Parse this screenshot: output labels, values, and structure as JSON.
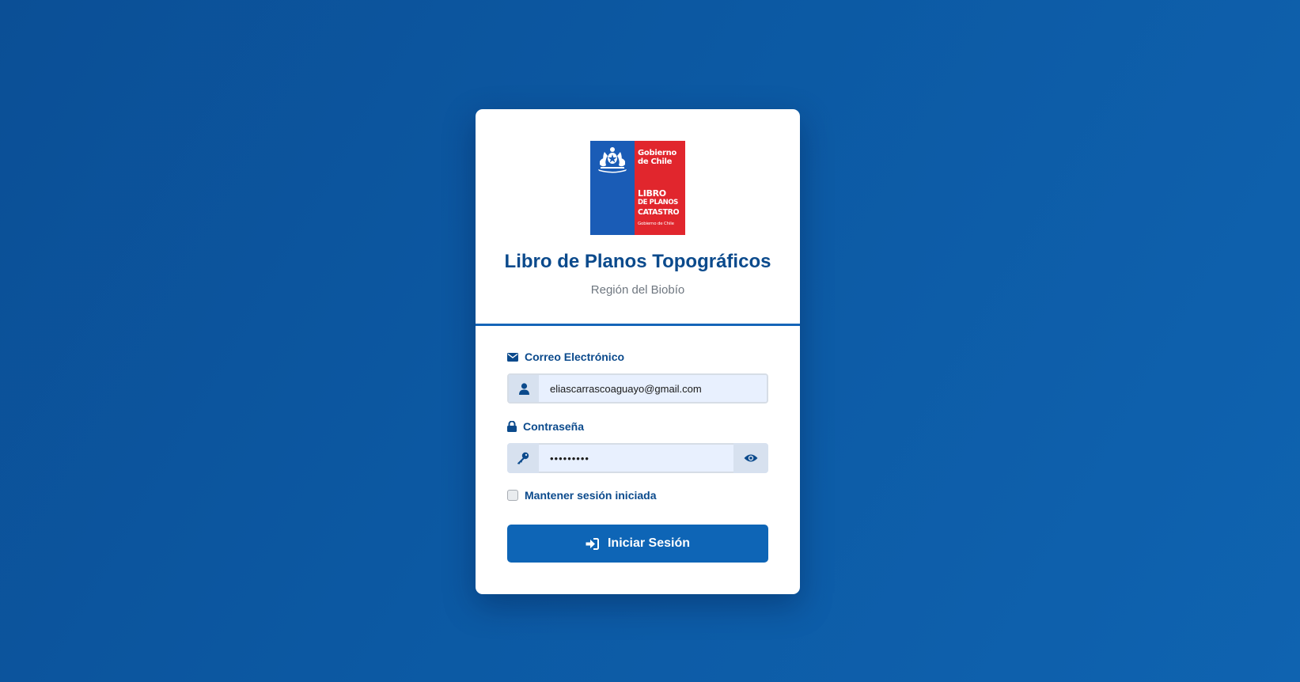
{
  "logo": {
    "line1": "Gobierno",
    "line2": "de Chile",
    "line3": "LIBRO",
    "line4": "DE PLANOS",
    "line5": "CATASTRO",
    "line6": "Gobierno de Chile"
  },
  "header": {
    "title": "Libro de Planos Topográficos",
    "subtitle": "Región del Biobío"
  },
  "form": {
    "email_label": "Correo Electrónico",
    "email_value": "eliascarrascoaguayo@gmail.com",
    "password_label": "Contraseña",
    "password_value": "•••••••••",
    "remember_label": "Mantener sesión iniciada",
    "submit_label": "Iniciar Sesión"
  },
  "colors": {
    "primary": "#0e65b6",
    "title": "#0b4a8c",
    "logo_blue": "#1a5cb6",
    "logo_red": "#e1262d",
    "background": "#0c59a3"
  },
  "icons": [
    "envelope-icon",
    "user-icon",
    "lock-icon",
    "key-icon",
    "eye-icon",
    "sign-in-icon",
    "coat-of-arms-icon"
  ]
}
